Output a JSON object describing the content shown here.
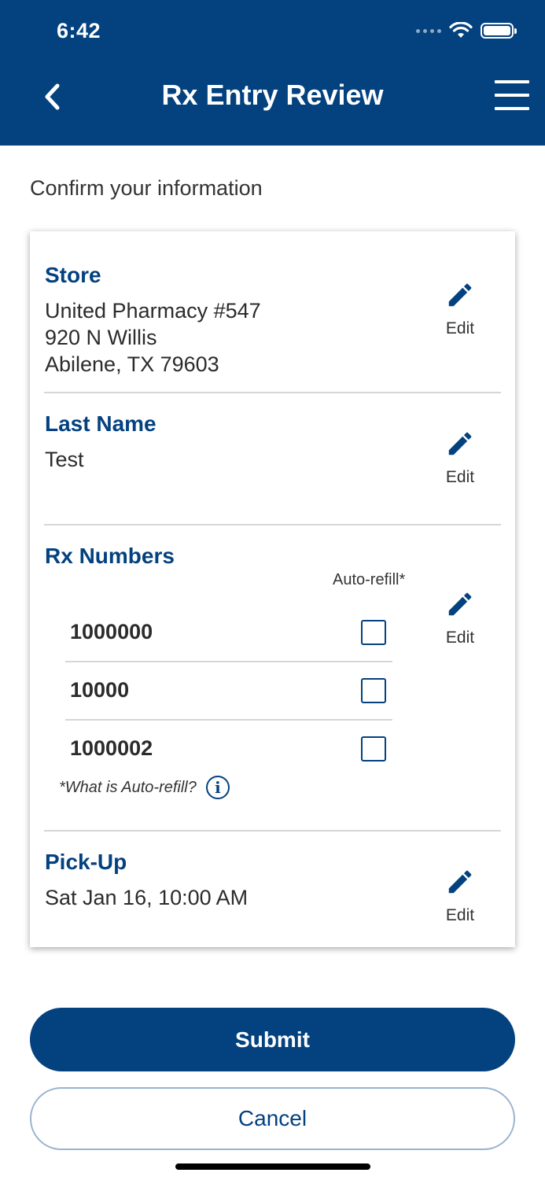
{
  "status_bar": {
    "time": "6:42"
  },
  "nav": {
    "title": "Rx Entry Review",
    "back_icon": "chevron-left-icon",
    "menu_icon": "hamburger-menu-icon"
  },
  "intro": "Confirm your information",
  "store": {
    "title": "Store",
    "lines": [
      "United Pharmacy #547",
      "920 N Willis",
      "Abilene, TX 79603"
    ],
    "edit_label": "Edit"
  },
  "last_name": {
    "title": "Last Name",
    "value": "Test",
    "edit_label": "Edit"
  },
  "rx_numbers": {
    "title": "Rx Numbers",
    "auto_refill_header": "Auto-refill*",
    "items": [
      {
        "number": "1000000",
        "auto_refill": false
      },
      {
        "number": "10000",
        "auto_refill": false
      },
      {
        "number": "1000002",
        "auto_refill": false
      }
    ],
    "note": "*What is Auto-refill?",
    "edit_label": "Edit"
  },
  "pickup": {
    "title": "Pick-Up",
    "value": "Sat Jan 16, 10:00 AM",
    "edit_label": "Edit"
  },
  "buttons": {
    "submit": "Submit",
    "cancel": "Cancel"
  },
  "colors": {
    "brand": "#03417f",
    "divider": "#d6d6d6"
  }
}
